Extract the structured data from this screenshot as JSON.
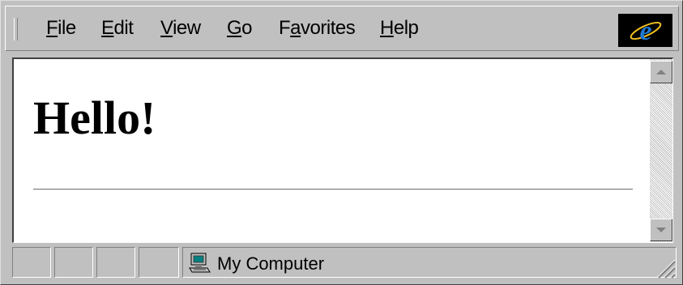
{
  "menubar": {
    "items": [
      {
        "label": "File",
        "accel": "F",
        "rest": "ile"
      },
      {
        "label": "Edit",
        "accel": "E",
        "rest": "dit"
      },
      {
        "label": "View",
        "accel": "V",
        "rest": "iew"
      },
      {
        "label": "Go",
        "accel": "G",
        "rest": "o"
      },
      {
        "label": "Favorites",
        "accel_pre": "F",
        "accel": "a",
        "rest": "vorites"
      },
      {
        "label": "Help",
        "accel": "H",
        "rest": "elp"
      }
    ],
    "logo_icon": "internet-explorer-logo-icon"
  },
  "content": {
    "heading": "Hello!"
  },
  "statusbar": {
    "zone_label": "My Computer",
    "zone_icon": "my-computer-icon"
  },
  "colors": {
    "chrome": "#c0c0c0",
    "logo_bg": "#000000",
    "logo_e": "#1e78d2",
    "page_bg": "#ffffff"
  }
}
